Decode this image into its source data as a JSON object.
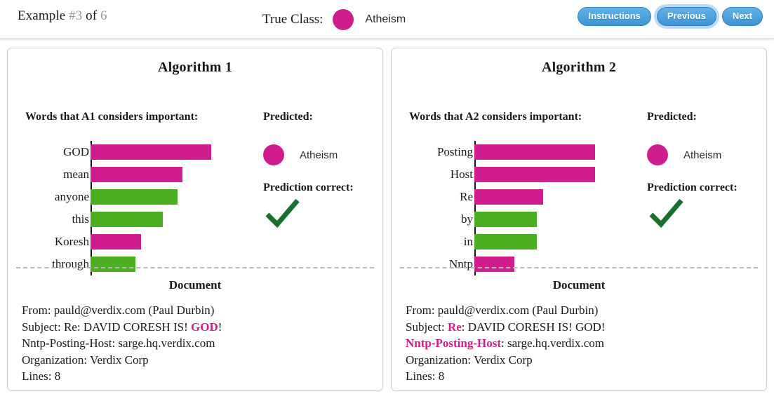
{
  "header": {
    "example_prefix": "Example ",
    "example_number": "#3",
    "example_middle": " of ",
    "example_total": "6",
    "true_class_label": "True Class:",
    "true_class_value": "Atheism",
    "true_class_color": "#d01d8d",
    "buttons": {
      "instructions": "Instructions",
      "previous": "Previous",
      "next": "Next"
    }
  },
  "colors": {
    "positive_bar": "#d01d8d",
    "negative_bar": "#4caf22",
    "check_green": "#18702f",
    "button_blue": "#3e94d4",
    "highlight": "#d01d8d"
  },
  "panels": [
    {
      "title": "Algorithm 1",
      "words_heading": "Words that A1 considers important:",
      "predicted_heading": "Predicted:",
      "predicted_class": "Atheism",
      "prediction_correct_heading": "Prediction correct:",
      "prediction_correct_icon": "check-mark",
      "document_title": "Document",
      "document_lines": [
        [
          {
            "text": "From: pauld@verdix.com (Paul Durbin)",
            "highlight": false
          }
        ],
        [
          {
            "text": "Subject: Re: DAVID CORESH IS! ",
            "highlight": false
          },
          {
            "text": "GOD",
            "highlight": true
          },
          {
            "text": "!",
            "highlight": false
          }
        ],
        [
          {
            "text": "Nntp-Posting-Host: sarge.hq.verdix.com",
            "highlight": false
          }
        ],
        [
          {
            "text": "Organization: Verdix Corp",
            "highlight": false
          }
        ],
        [
          {
            "text": "Lines: 8",
            "highlight": false
          }
        ]
      ],
      "chart_data": {
        "type": "bar",
        "orientation": "horizontal",
        "title": "Words that A1 considers important:",
        "xlabel": "",
        "ylabel": "",
        "categories": [
          "GOD",
          "mean",
          "anyone",
          "this",
          "Koresh",
          "through"
        ],
        "values": [
          1.0,
          0.76,
          0.72,
          0.6,
          0.42,
          0.37
        ],
        "bar_colors": [
          "#d01d8d",
          "#d01d8d",
          "#4caf22",
          "#4caf22",
          "#d01d8d",
          "#4caf22"
        ],
        "signs": [
          "positive",
          "positive",
          "negative",
          "negative",
          "positive",
          "negative"
        ],
        "xlim": [
          0,
          1
        ],
        "grid": false,
        "legend": false
      }
    },
    {
      "title": "Algorithm 2",
      "words_heading": "Words that A2 considers important:",
      "predicted_heading": "Predicted:",
      "predicted_class": "Atheism",
      "prediction_correct_heading": "Prediction correct:",
      "prediction_correct_icon": "check-mark",
      "document_title": "Document",
      "document_lines": [
        [
          {
            "text": "From: pauld@verdix.com (Paul Durbin)",
            "highlight": false
          }
        ],
        [
          {
            "text": "Subject: ",
            "highlight": false
          },
          {
            "text": "Re",
            "highlight": true
          },
          {
            "text": ": DAVID CORESH IS! GOD!",
            "highlight": false
          }
        ],
        [
          {
            "text": "Nntp-Posting-Host",
            "highlight": true
          },
          {
            "text": ": sarge.hq.verdix.com",
            "highlight": false
          }
        ],
        [
          {
            "text": "Organization: Verdix Corp",
            "highlight": false
          }
        ],
        [
          {
            "text": "Lines: 8",
            "highlight": false
          }
        ]
      ],
      "chart_data": {
        "type": "bar",
        "orientation": "horizontal",
        "title": "Words that A2 considers important:",
        "xlabel": "",
        "ylabel": "",
        "categories": [
          "Posting",
          "Host",
          "Re",
          "by",
          "in",
          "Nntp"
        ],
        "values": [
          1.0,
          1.0,
          0.57,
          0.52,
          0.52,
          0.33
        ],
        "bar_colors": [
          "#d01d8d",
          "#d01d8d",
          "#d01d8d",
          "#4caf22",
          "#4caf22",
          "#d01d8d"
        ],
        "signs": [
          "positive",
          "positive",
          "positive",
          "negative",
          "negative",
          "positive"
        ],
        "xlim": [
          0,
          1
        ],
        "grid": false,
        "legend": false
      }
    }
  ]
}
